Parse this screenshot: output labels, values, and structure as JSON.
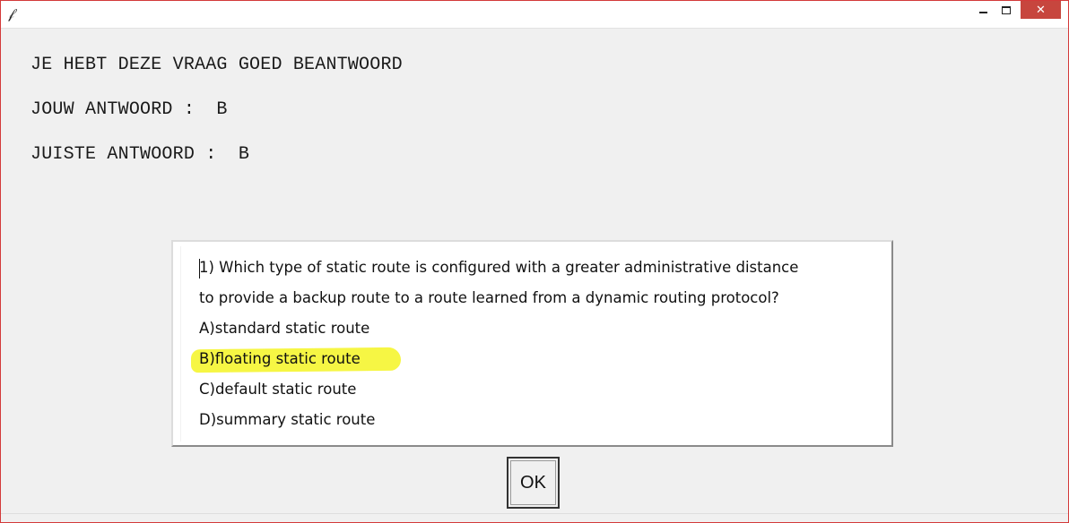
{
  "window": {
    "app_icon": "feather-icon",
    "controls": {
      "minimize": "minimize-icon",
      "maximize": "maximize-icon",
      "close": "✕"
    }
  },
  "result": {
    "status": "JE HEBT DEZE VRAAG GOED BEANTWOORD",
    "your_answer": "JOUW ANTWOORD :  B",
    "correct_answer": "JUISTE ANTWOORD :  B"
  },
  "question": {
    "line1": "1) Which type of static route is configured with a greater administrative distance",
    "line2": "to provide a backup route to a route learned from a dynamic routing protocol?",
    "options": [
      "A)standard static route",
      "B)floating static route",
      "C)default static route",
      "D)summary static route"
    ],
    "highlight_color": "#f5f53a"
  },
  "buttons": {
    "ok_label": "OK"
  }
}
